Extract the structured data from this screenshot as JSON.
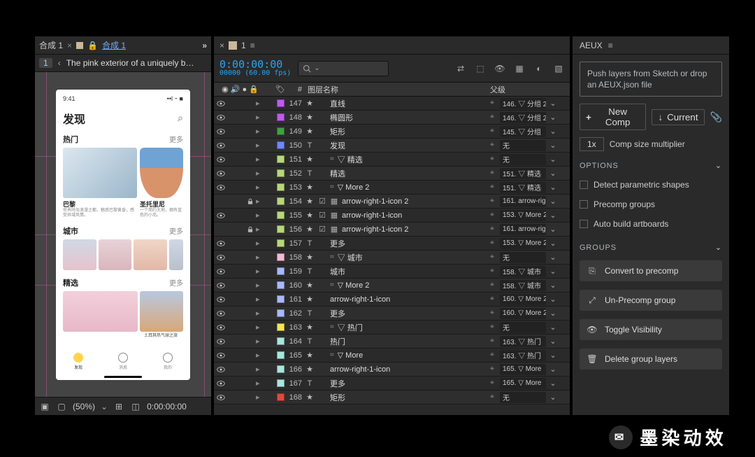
{
  "left": {
    "tab1": "合成 1",
    "tab2": "合成 1",
    "flowNum": "1",
    "flowText": "The pink exterior of a uniquely b…",
    "zoom": "(50%)",
    "footerTime": "0:00:00:00"
  },
  "mock": {
    "time": "9:41",
    "title": "发现",
    "sec1": "热门",
    "sec1_card1": "巴黎",
    "sec1_card2": "圣托里尼",
    "sec1_sub1": "世界时尚浪漫之都，魅惑巴黎黄昏，感受异域风情。",
    "sec1_sub2": "一个简约大地，拥有蓝色的小岛。",
    "sec2": "城市",
    "sec3": "精选",
    "pinkLabel": "土耳其热气球之旅",
    "more": "更多",
    "tab1": "发现",
    "tab2": "消息",
    "tab3": "我的"
  },
  "mid": {
    "tabNum": "1",
    "timecode": "0:00:00:00",
    "timeSub": "00000 (60.00 fps)",
    "h_idx": "#",
    "h_name": "图层名称",
    "h_parent": "父级"
  },
  "layers": [
    {
      "i": 147,
      "c": "#bf5af0",
      "k": "star",
      "n": "直线",
      "p": "146. ▽ 分组 2",
      "v": 1
    },
    {
      "i": 148,
      "c": "#bf5af0",
      "k": "star",
      "n": "椭圆形",
      "p": "146. ▽ 分组 2",
      "v": 1
    },
    {
      "i": 149,
      "c": "#3fa23f",
      "k": "star",
      "n": "矩形",
      "p": "145. ▽ 分组",
      "v": 1
    },
    {
      "i": 150,
      "c": "#6e86ff",
      "k": "T",
      "n": "发现",
      "p": "无",
      "v": 1
    },
    {
      "i": 151,
      "c": "#b7d77a",
      "k": "star",
      "shy": 1,
      "n": "▽ 精选",
      "p": "无",
      "v": 1
    },
    {
      "i": 152,
      "c": "#b7d77a",
      "k": "T",
      "n": "精选",
      "p": "151. ▽ 精选",
      "v": 1
    },
    {
      "i": 153,
      "c": "#b7d77a",
      "k": "star",
      "shy": 1,
      "n": "▽ More 2",
      "p": "151. ▽ 精选",
      "v": 1
    },
    {
      "i": 154,
      "c": "#b7d77a",
      "k": "star",
      "chk": 1,
      "pre": 1,
      "lock": 1,
      "n": "arrow-right-1-icon 2",
      "p": "161. arrow-righ"
    },
    {
      "i": 155,
      "c": "#b7d77a",
      "k": "star",
      "chk": 1,
      "pre": 1,
      "n": "arrow-right-1-icon",
      "p": "153. ▽ More 2",
      "v": 1
    },
    {
      "i": 156,
      "c": "#b7d77a",
      "k": "star",
      "chk": 1,
      "pre": 1,
      "lock": 1,
      "n": "arrow-right-1-icon 2",
      "p": "161. arrow-righ"
    },
    {
      "i": 157,
      "c": "#b7d77a",
      "k": "T",
      "n": "更多",
      "p": "153. ▽ More 2",
      "v": 1
    },
    {
      "i": 158,
      "c": "#f6b9d6",
      "k": "star",
      "shy": 1,
      "n": "▽ 城市",
      "p": "无",
      "v": 1
    },
    {
      "i": 159,
      "c": "#aab7ff",
      "k": "T",
      "n": "城市",
      "p": "158. ▽ 城市",
      "v": 1
    },
    {
      "i": 160,
      "c": "#aab7ff",
      "k": "star",
      "shy": 1,
      "n": "▽ More 2",
      "p": "158. ▽ 城市",
      "v": 1
    },
    {
      "i": 161,
      "c": "#aab7ff",
      "k": "star",
      "n": "arrow-right-1-icon",
      "p": "160. ▽ More 2",
      "v": 1
    },
    {
      "i": 162,
      "c": "#aab7ff",
      "k": "T",
      "n": "更多",
      "p": "160. ▽ More 2",
      "v": 1
    },
    {
      "i": 163,
      "c": "#f5e64e",
      "k": "star",
      "shy": 1,
      "n": "▽ 热门",
      "p": "无",
      "v": 1
    },
    {
      "i": 164,
      "c": "#a8e6df",
      "k": "T",
      "n": "热门",
      "p": "163. ▽ 热门",
      "v": 1
    },
    {
      "i": 165,
      "c": "#a8e6df",
      "k": "star",
      "shy": 1,
      "n": "▽ More",
      "p": "163. ▽ 热门",
      "v": 1
    },
    {
      "i": 166,
      "c": "#a8e6df",
      "k": "star",
      "n": "arrow-right-1-icon",
      "p": "165. ▽ More",
      "v": 1
    },
    {
      "i": 167,
      "c": "#a8e6df",
      "k": "T",
      "n": "更多",
      "p": "165. ▽ More",
      "v": 1
    },
    {
      "i": 168,
      "c": "#e04a3a",
      "k": "star",
      "n": "矩形",
      "p": "无",
      "v": 1
    }
  ],
  "aeux": {
    "title": "AEUX",
    "dropText": "Push layers from Sketch or drop an AEUX.json file",
    "newComp": "New Comp",
    "current": "Current",
    "multVal": "1x",
    "multLabel": "Comp size multiplier",
    "sec_options": "OPTIONS",
    "opt1": "Detect parametric shapes",
    "opt2": "Precomp groups",
    "opt3": "Auto build artboards",
    "sec_groups": "GROUPS",
    "g1": "Convert to precomp",
    "g2": "Un-Precomp group",
    "g3": "Toggle Visibility",
    "g4": "Delete group layers"
  },
  "watermark": "墨染动效"
}
